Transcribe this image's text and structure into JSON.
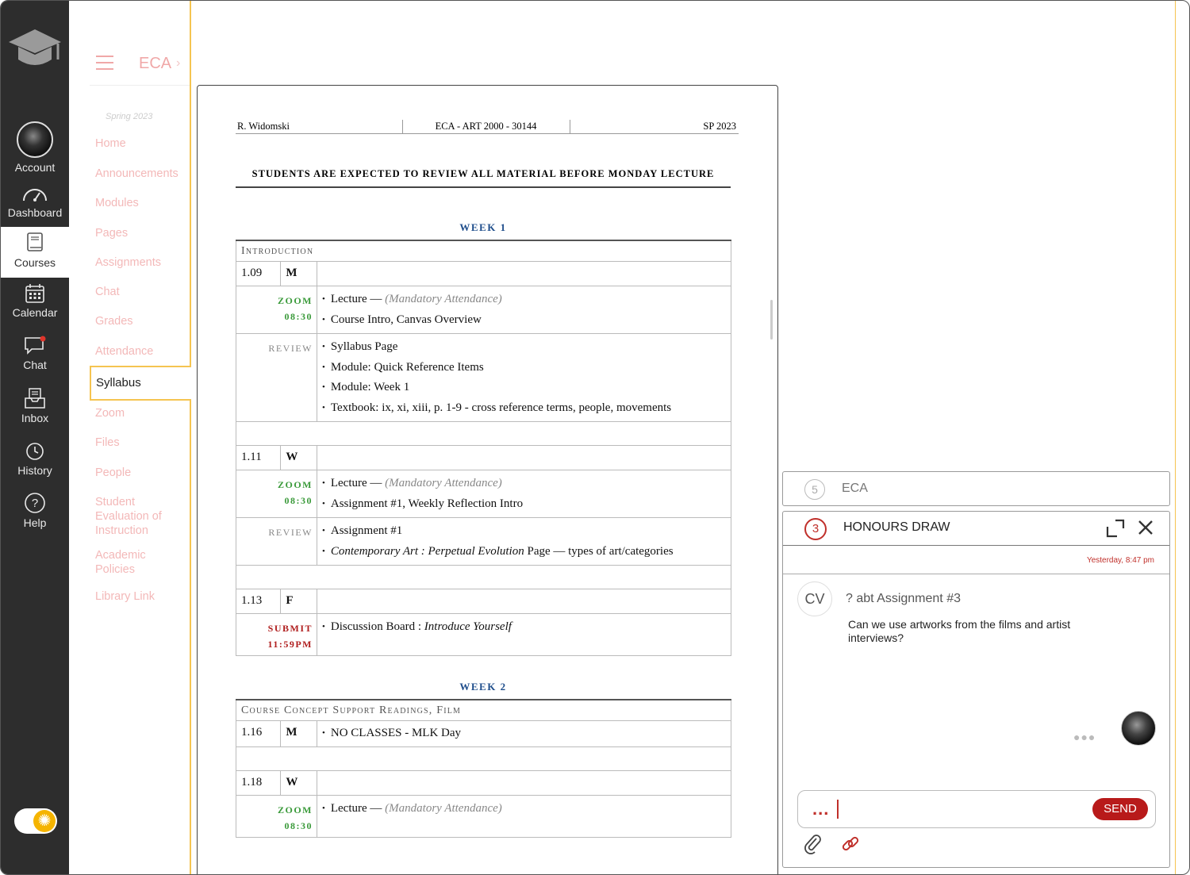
{
  "global_nav": {
    "account": "Account",
    "dashboard": "Dashboard",
    "courses": "Courses",
    "calendar": "Calendar",
    "chat": "Chat",
    "inbox": "Inbox",
    "history": "History",
    "help": "Help"
  },
  "course_nav": {
    "breadcrumb": "ECA",
    "term": "Spring 2023",
    "links": [
      "Home",
      "Announcements",
      "Modules",
      "Pages",
      "Assignments",
      "Chat",
      "Grades",
      "Attendance"
    ],
    "active": "Syllabus",
    "links_after": [
      "Zoom",
      "Files",
      "People",
      "Student",
      "Evaluation of",
      "Instruction",
      "Academic",
      "Policies",
      "Library Link"
    ]
  },
  "syllabus": {
    "header": {
      "instructor": "R. Widomski",
      "course": "ECA - ART 2000 - 30144",
      "term": "SP 2023"
    },
    "notice": "STUDENTS ARE EXPECTED TO REVIEW ALL MATERIAL BEFORE MONDAY LECTURE",
    "week1": {
      "title": "WEEK 1",
      "section": "Introduction",
      "d1": {
        "date": "1.09",
        "day": "M",
        "tag1": "ZOOM",
        "time1": "08:30",
        "lecture": "Lecture — ",
        "attendance": "(Mandatory Attendance)",
        "item2": "Course Intro, Canvas Overview",
        "tag2": "REVIEW",
        "r1": "Syllabus Page",
        "r2": "Module: Quick Reference Items",
        "r3": "Module:  Week 1",
        "r4": "Textbook: ix, xi, xiii, p. 1-9 - cross reference terms, people, movements"
      },
      "d2": {
        "date": "1.11",
        "day": "W",
        "tag1": "ZOOM",
        "time1": "08:30",
        "lecture": "Lecture — ",
        "attendance": "(Mandatory Attendance)",
        "item2": "Assignment #1, Weekly Reflection Intro",
        "tag2": "REVIEW",
        "r1": "Assignment #1",
        "r2a": "Contemporary Art : Perpetual Evolution",
        "r2b": " Page  — types of art/categories"
      },
      "d3": {
        "date": "1.13",
        "day": "F",
        "tag1": "SUBMIT",
        "time1": "11:59PM",
        "item1a": "Discussion Board : ",
        "item1b": "Introduce Yourself"
      }
    },
    "week2": {
      "title": "WEEK 2",
      "section": "Course Concept Support Readings, Film",
      "d1": {
        "date": "1.16",
        "day": "M",
        "item": "NO CLASSES  -  MLK Day"
      },
      "d2": {
        "date": "1.18",
        "day": "W",
        "tag1": "ZOOM",
        "time1": "08:30",
        "lecture": "Lecture — ",
        "attendance": "(Mandatory Attendance)"
      }
    }
  },
  "chat": {
    "minimized": {
      "count": "5",
      "title": "ECA"
    },
    "window": {
      "count": "3",
      "title": "HONOURS DRAW",
      "timestamp": "Yesterday, 8:47 pm",
      "sender_initials": "CV",
      "message_title": "? abt Assignment #3",
      "message_body": "Can we use artworks from the films and artist interviews?",
      "typing": "●●●",
      "input_value": "...",
      "send_label": "SEND"
    }
  },
  "colors": {
    "accent_yellow": "#f5c451",
    "link_pink": "#f3b8b8",
    "send_red": "#b81a1a",
    "zoom_green": "#3a9a3a",
    "week_blue": "#1f4e8c"
  }
}
